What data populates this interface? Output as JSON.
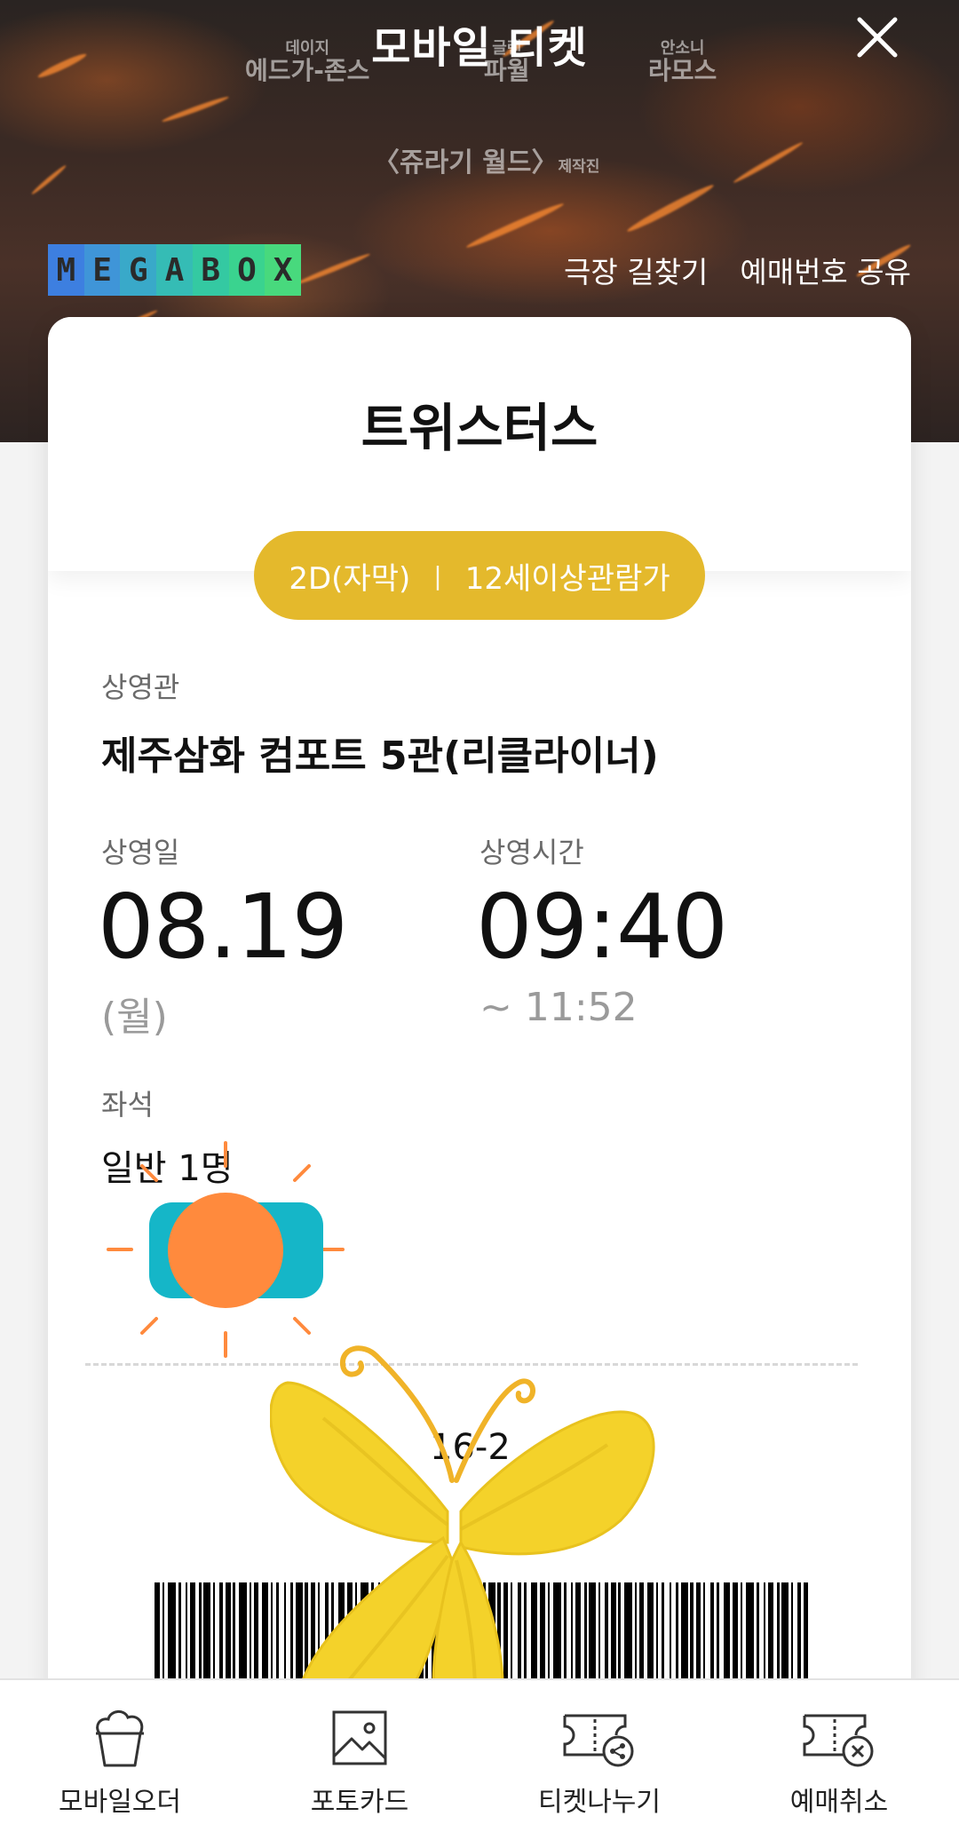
{
  "header": {
    "title": "모바일 티켓",
    "close_icon": "close-icon"
  },
  "poster": {
    "credits": [
      {
        "small": "데이지",
        "big": "에드가-존스"
      },
      {
        "small": "글렌",
        "big": "파월"
      },
      {
        "small": "안소니",
        "big": "라모스"
      }
    ],
    "jurassic": "〈쥬라기 월드〉",
    "jurassic_suffix": "제작진"
  },
  "brand": {
    "letters": [
      "M",
      "E",
      "G",
      "A",
      "B",
      "O",
      "X"
    ],
    "colors": [
      "#3d7fe0",
      "#3f95d8",
      "#39a9c9",
      "#35bcb5",
      "#34c9a2",
      "#3ad38f",
      "#48d97d"
    ]
  },
  "links": {
    "find_theater": "극장 길찾기",
    "share_booking": "예매번호 공유"
  },
  "ticket": {
    "movie_title": "트위스터스",
    "format": "2D(자막)",
    "separator": "|",
    "rating": "12세이상관람가",
    "theater_label": "상영관",
    "theater": "제주삼화 컴포트 5관(리클라이너)",
    "date_label": "상영일",
    "date": "08.19",
    "weekday": "(월)",
    "time_label": "상영시간",
    "start_time": "09:40",
    "end_time": "~  11:52",
    "seat_label": "좌석",
    "seat": "일반 1명",
    "booking_code": "16-2"
  },
  "colors": {
    "pill": "#e4b92c",
    "sun": "#ff8a3d",
    "badge": "#15b6c8",
    "butterfly": "#f4d22a"
  },
  "bottom_actions": [
    {
      "label": "모바일오더",
      "icon": "popcorn-icon"
    },
    {
      "label": "포토카드",
      "icon": "image-icon"
    },
    {
      "label": "티켓나누기",
      "icon": "ticket-share-icon"
    },
    {
      "label": "예매취소",
      "icon": "ticket-cancel-icon"
    }
  ]
}
